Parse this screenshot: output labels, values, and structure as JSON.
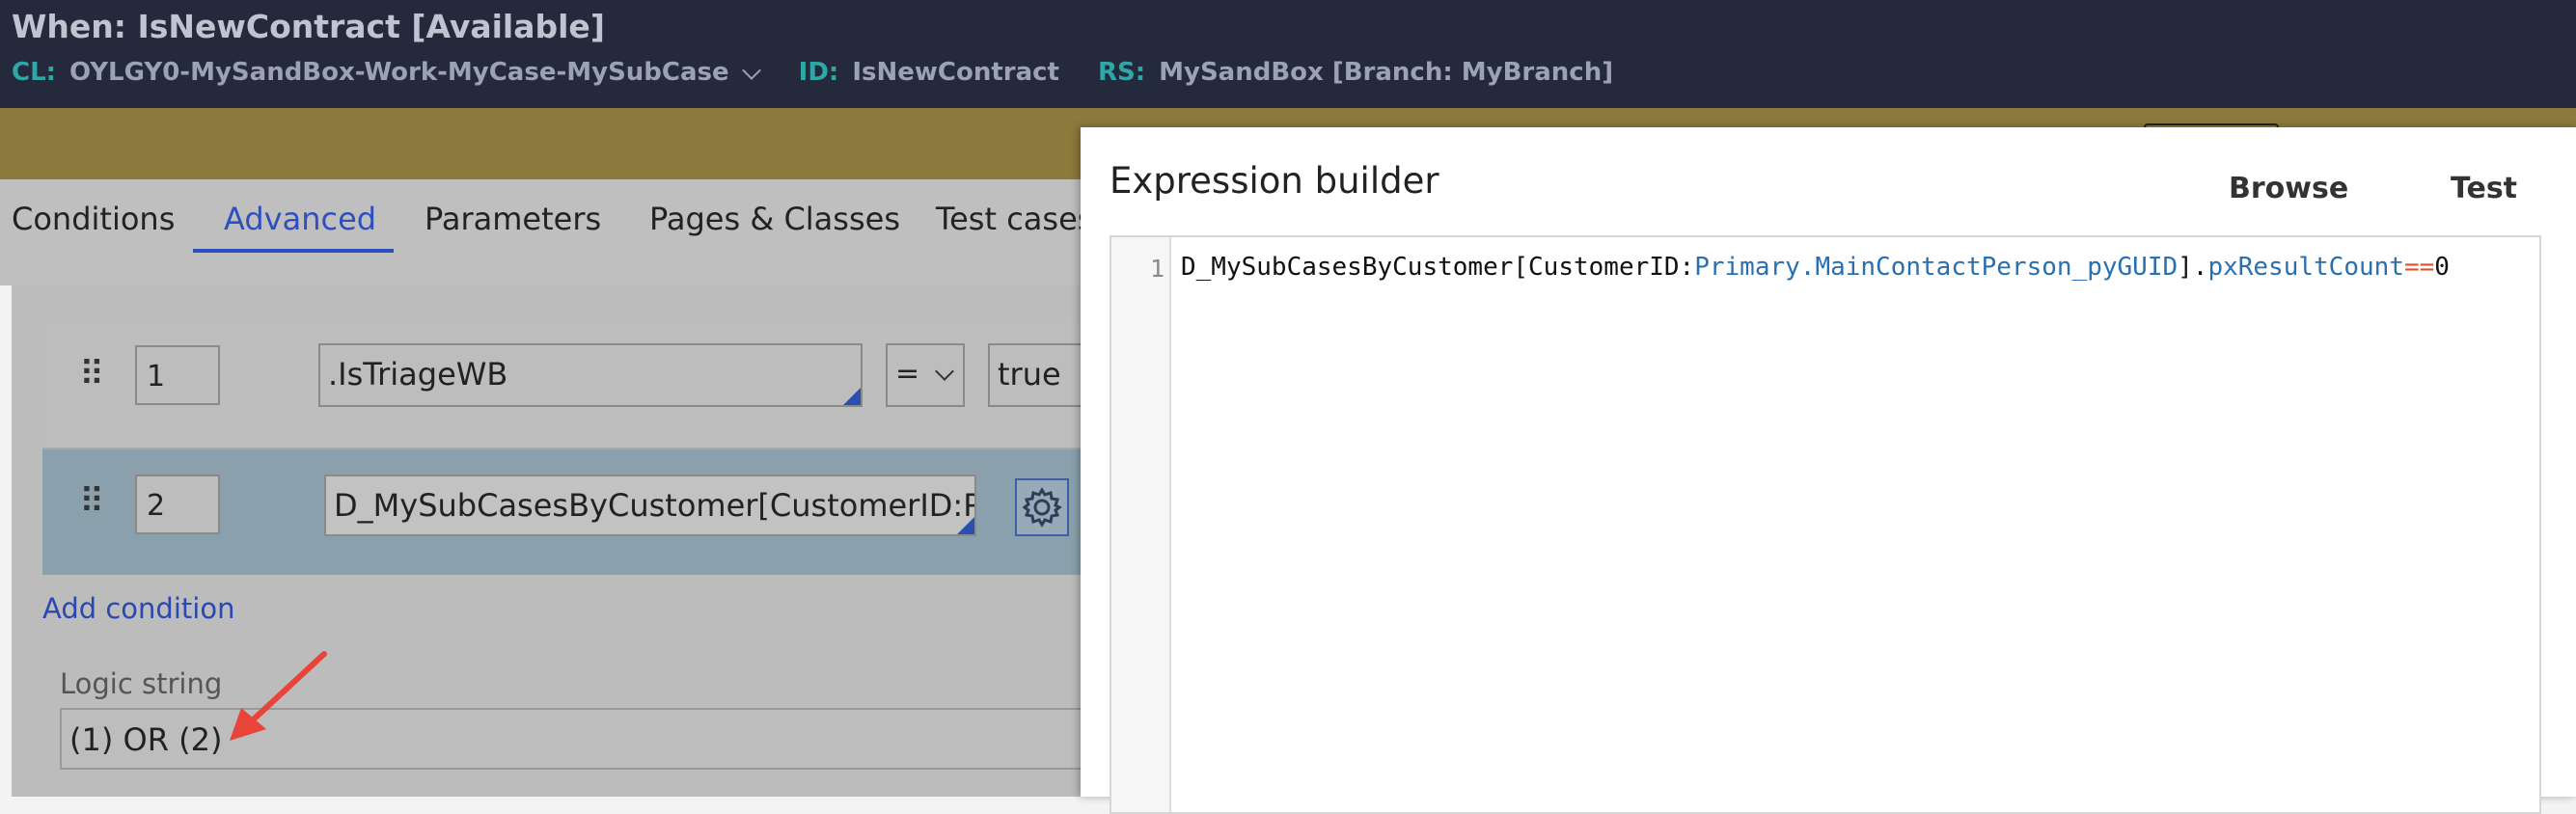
{
  "header": {
    "title": "When: IsNewContract [Available]",
    "cl_label": "CL:",
    "cl_value": "OYLGY0-MySandBox-Work-MyCase-MySubCase",
    "id_label": "ID:",
    "id_value": "IsNewContract",
    "rs_label": "RS:",
    "rs_value": "MySandBox [Branch: MyBranch]"
  },
  "tabs": [
    {
      "label": "Conditions"
    },
    {
      "label": "Advanced"
    },
    {
      "label": "Parameters"
    },
    {
      "label": "Pages & Classes"
    },
    {
      "label": "Test cases"
    }
  ],
  "conditions": [
    {
      "number": "1",
      "property": ".IsTriageWB",
      "operator": "=",
      "value": "true"
    },
    {
      "number": "2",
      "expression": "D_MySubCasesByCustomer[CustomerID:Prim"
    }
  ],
  "add_condition_label": "Add condition",
  "logic": {
    "label": "Logic string",
    "value": "(1) OR (2)"
  },
  "expression_builder": {
    "title": "Expression builder",
    "browse_label": "Browse",
    "test_label": "Test",
    "line_number": "1",
    "code_tokens": [
      {
        "text": "D_MySubCasesByCustomer[CustomerID:",
        "color": "#111111"
      },
      {
        "text": "Primary.MainContactPerson_pyGUID",
        "color": "#2a6fb0"
      },
      {
        "text": "].",
        "color": "#111111"
      },
      {
        "text": "pxResultCount",
        "color": "#2a6fb0"
      },
      {
        "text": "==",
        "color": "#e0502a"
      },
      {
        "text": "0",
        "color": "#111111"
      }
    ]
  },
  "colors": {
    "accent": "#2f4fbf",
    "annotation_arrow": "#e8443a"
  }
}
